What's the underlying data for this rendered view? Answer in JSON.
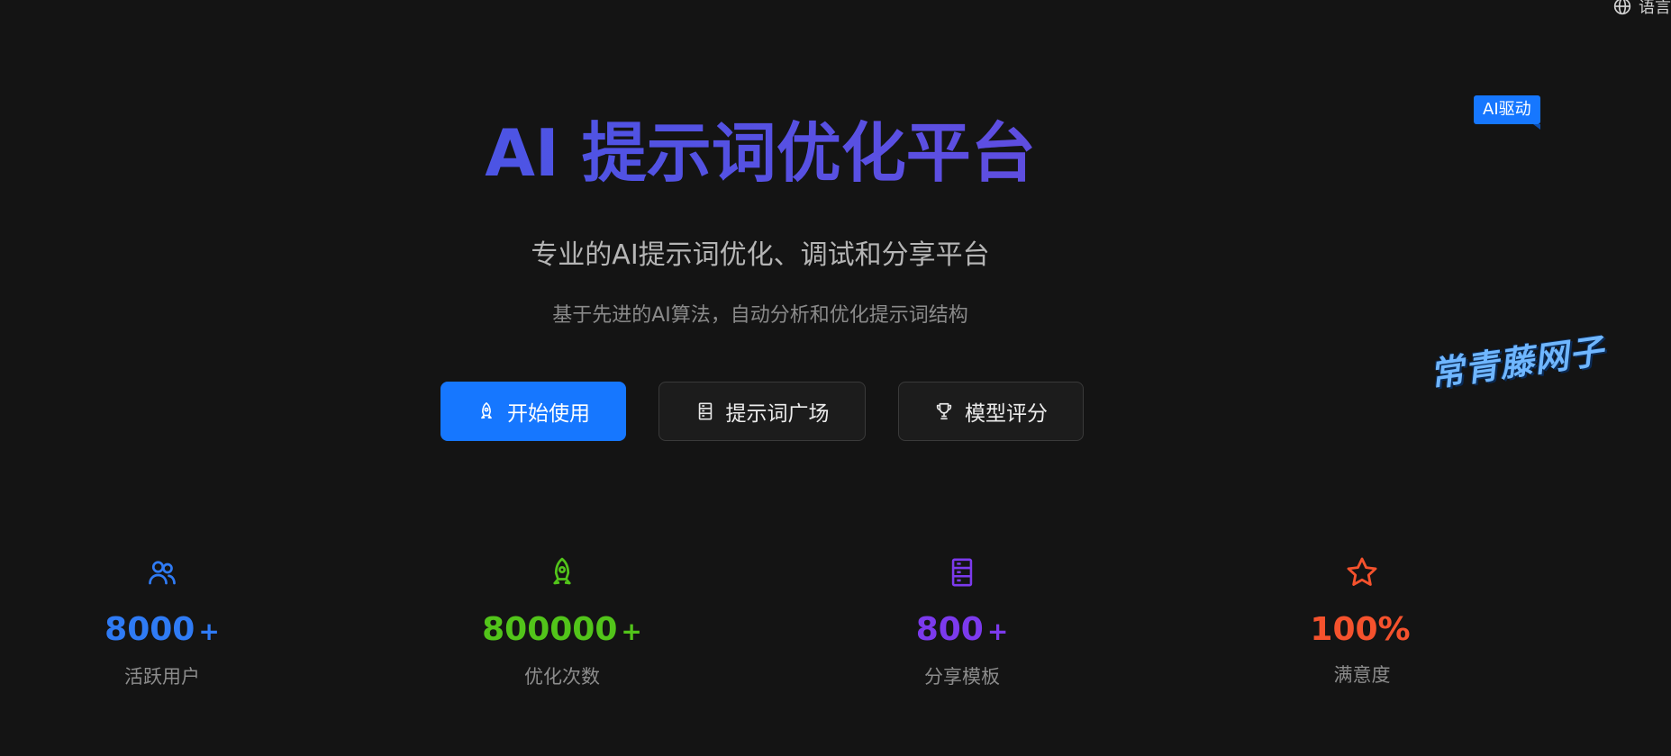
{
  "header": {
    "language_label": "语言",
    "language_icon": "globe-icon"
  },
  "badge": {
    "label": "AI驱动",
    "color": "#1677ff"
  },
  "watermark": {
    "text": "常青藤网子"
  },
  "hero": {
    "title": "AI 提示词优化平台",
    "subtitle": "专业的AI提示词优化、调试和分享平台",
    "description": "基于先进的AI算法，自动分析和优化提示词结构",
    "title_gradient": [
      "#3b5ae6",
      "#6a48d8"
    ]
  },
  "actions": [
    {
      "label": "开始使用",
      "icon": "rocket-icon",
      "style": "primary"
    },
    {
      "label": "提示词广场",
      "icon": "database-icon",
      "style": "default"
    },
    {
      "label": "模型评分",
      "icon": "trophy-icon",
      "style": "default"
    }
  ],
  "stats": [
    {
      "value": "8000",
      "suffix": "+",
      "label": "活跃用户",
      "icon": "users-icon",
      "color": "#2f7bf5"
    },
    {
      "value": "800000",
      "suffix": "+",
      "label": "优化次数",
      "icon": "rocket-icon",
      "color": "#52c41a"
    },
    {
      "value": "800",
      "suffix": "+",
      "label": "分享模板",
      "icon": "database-icon",
      "color": "#7c3aed"
    },
    {
      "value": "100%",
      "suffix": "",
      "label": "满意度",
      "icon": "star-icon",
      "color": "#f5522d"
    }
  ]
}
